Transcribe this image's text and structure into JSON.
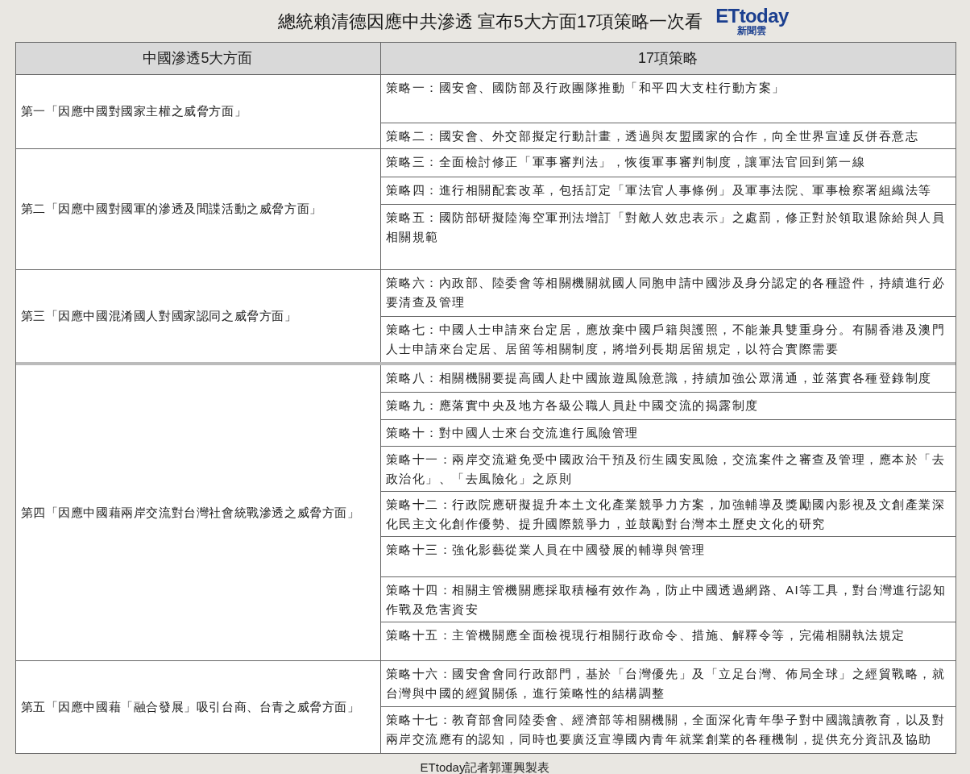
{
  "title": "總統賴清德因應中共滲透 宣布5大方面17項策略一次看",
  "logo": {
    "brand": "ETtoday",
    "sub": "新聞雲"
  },
  "table": {
    "columns": [
      "中國滲透5大方面",
      "17項策略"
    ],
    "groups": [
      {
        "aspect": "第一「因應中國對國家主權之威脅方面」",
        "strategies": [
          "策略一：國安會、國防部及行政團隊推動「和平四大支柱行動方案」",
          "策略二：國安會、外交部擬定行動計畫，透過與友盟國家的合作，向全世界宣達反併吞意志"
        ]
      },
      {
        "aspect": "第二「因應中國對國軍的滲透及間諜活動之威脅方面」",
        "strategies": [
          "策略三：全面檢討修正「軍事審判法」，恢復軍事審判制度，讓軍法官回到第一線",
          "策略四：進行相關配套改革，包括訂定「軍法官人事條例」及軍事法院、軍事檢察署組織法等",
          "策略五：國防部研擬陸海空軍刑法增訂「對敵人效忠表示」之處罰，修正對於領取退除給與人員相關規範"
        ]
      },
      {
        "aspect": "第三「因應中國混淆國人對國家認同之威脅方面」",
        "strategies": [
          "策略六：內政部、陸委會等相關機關就國人同胞申請中國涉及身分認定的各種證件，持續進行必要清查及管理",
          "策略七：中國人士申請來台定居，應放棄中國戶籍與護照，不能兼具雙重身分。有關香港及澳門人士申請來台定居、居留等相關制度，將增列長期居留規定，以符合實際需要"
        ]
      },
      {
        "aspect": "第四「因應中國藉兩岸交流對台灣社會統戰滲透之威脅方面」",
        "strategies": [
          "策略八：相關機關要提高國人赴中國旅遊風險意識，持續加強公眾溝通，並落實各種登錄制度",
          "策略九：應落實中央及地方各級公職人員赴中國交流的揭露制度",
          "策略十：對中國人士來台交流進行風險管理",
          "策略十一：兩岸交流避免受中國政治干預及衍生國安風險，交流案件之審查及管理，應本於「去政治化」、「去風險化」之原則",
          "策略十二：行政院應研擬提升本土文化產業競爭力方案，加強輔導及獎勵國內影視及文創產業深化民主文化創作優勢、提升國際競爭力，並鼓勵對台灣本土歷史文化的研究",
          "策略十三：強化影藝從業人員在中國發展的輔導與管理",
          "策略十四：相關主管機關應採取積極有效作為，防止中國透過網路、AI等工具，對台灣進行認知作戰及危害資安",
          "策略十五：主管機關應全面檢視現行相關行政命令、措施、解釋令等，完備相關執法規定"
        ]
      },
      {
        "aspect": "第五「因應中國藉「融合發展」吸引台商、台青之威脅方面」",
        "strategies": [
          "策略十六：國安會會同行政部門，基於「台灣優先」及「立足台灣、佈局全球」之經貿戰略，就台灣與中國的經貿關係，進行策略性的結構調整",
          "策略十七：教育部會同陸委會、經濟部等相關機關，全面深化青年學子對中國識讀教育，以及對兩岸交流應有的認知，同時也要廣泛宣導國內青年就業創業的各種機制，提供充分資訊及協助"
        ]
      }
    ]
  },
  "credit": "ETtoday記者郭運興製表"
}
